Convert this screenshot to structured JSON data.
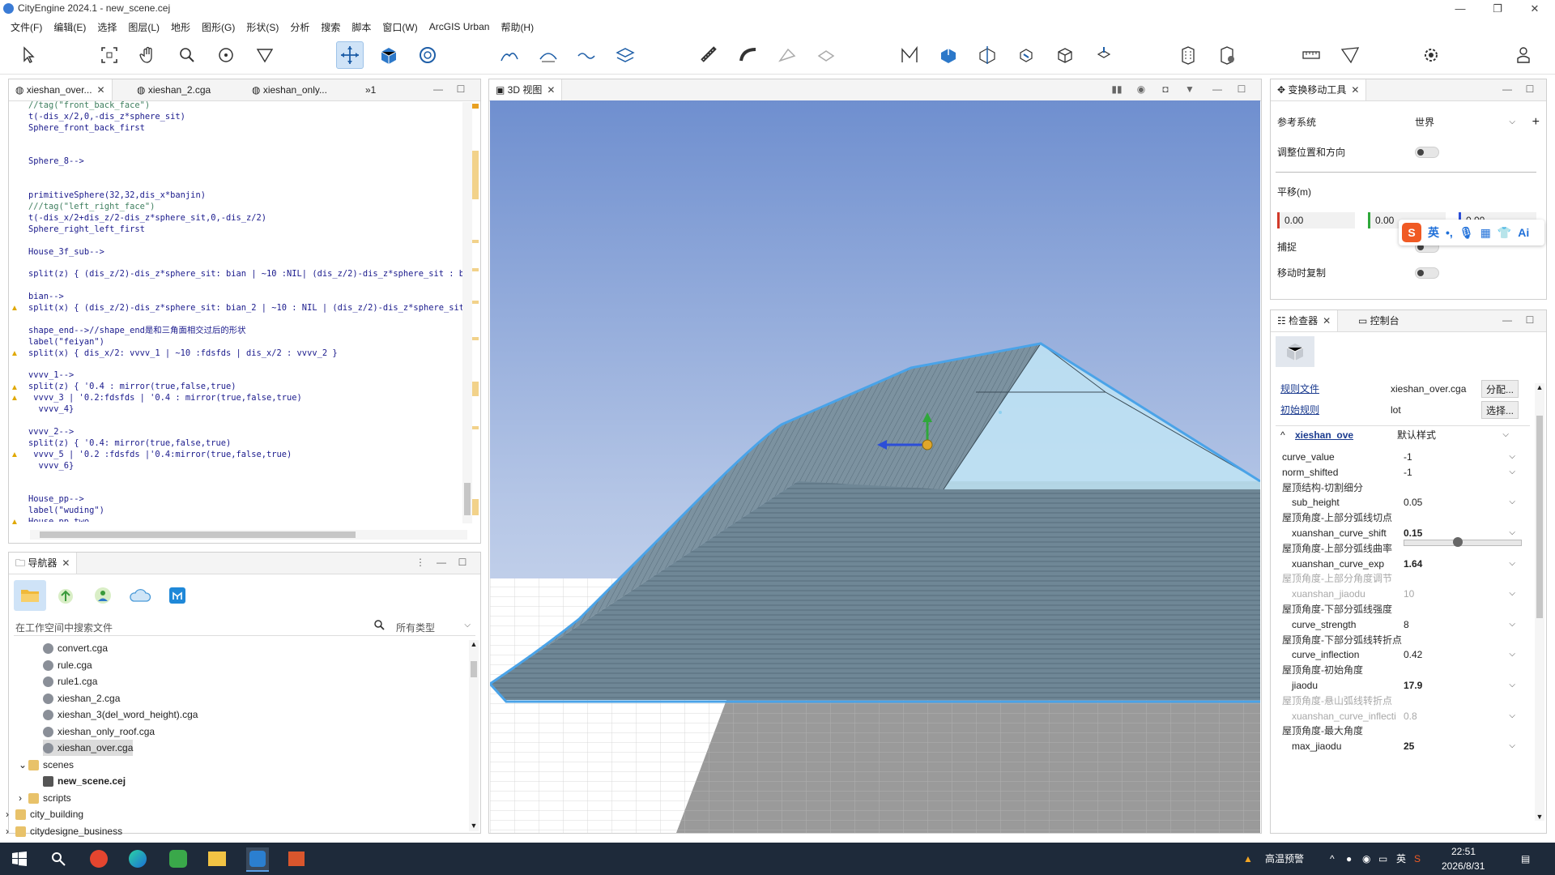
{
  "window": {
    "title": "CityEngine 2024.1 - new_scene.cej",
    "controls": [
      "—",
      "❐",
      "✕"
    ]
  },
  "menu": [
    "文件(F)",
    "编辑(E)",
    "选择",
    "图层(L)",
    "地形",
    "图形(G)",
    "形状(S)",
    "分析",
    "搜索",
    "脚本",
    "窗口(W)",
    "ArcGIS Urban",
    "帮助(H)"
  ],
  "editor": {
    "tabs": [
      "xieshan_over...",
      "xieshan_2.cga",
      "xieshan_only...",
      "»1"
    ],
    "lines": [
      "//tag(\"front_back_face\")",
      "t(-dis_x/2,0,-dis_z*sphere_sit)",
      "Sphere_front_back_first",
      "",
      "",
      "Sphere_8-->",
      "",
      "",
      "primitiveSphere(32,32,dis_x*banjin)",
      "///tag(\"left_right_face\")",
      "t(-dis_x/2+dis_z/2-dis_z*sphere_sit,0,-dis_z/2)",
      "Sphere_right_left_first",
      "",
      "House_3f_sub-->",
      "",
      "split(z) { (dis_z/2)-dis_z*sphere_sit: bian | ~10 :NIL| (dis_z/2)-dis_z*sphere_sit : bia",
      "",
      "bian-->",
      "split(x) { (dis_z/2)-dis_z*sphere_sit: bian_2 | ~10 : NIL | (dis_z/2)-dis_z*sphere_sit :",
      "",
      "shape_end-->//shape_end是和三角面相交过后的形状",
      "label(\"feiyan\")",
      "split(x) { dis_x/2: vvvv_1 | ~10 :fdsfds | dis_x/2 : vvvv_2 }",
      "",
      "vvvv_1-->",
      "split(z) { '0.4 : mirror(true,false,true)",
      " vvvv_3 | '0.2:fdsfds | '0.4 : mirror(true,false,true)",
      "  vvvv_4}",
      "",
      "vvvv_2-->",
      "split(z) { '0.4: mirror(true,false,true)",
      " vvvv_5 | '0.2 :fdsfds |'0.4:mirror(true,false,true)",
      "  vvvv_6}",
      "",
      "",
      "House_pp-->",
      "label(\"wuding\")",
      "House_pp_two"
    ]
  },
  "navigator": {
    "tab": "导航器",
    "search_placeholder": "在工作空间中搜索文件",
    "type_filter": "所有类型",
    "tree": [
      {
        "label": "convert.cga",
        "kind": "cga",
        "level": 2
      },
      {
        "label": "rule.cga",
        "kind": "cga",
        "level": 2
      },
      {
        "label": "rule1.cga",
        "kind": "cga",
        "level": 2
      },
      {
        "label": "xieshan_2.cga",
        "kind": "cga",
        "level": 2
      },
      {
        "label": "xieshan_3(del_word_height).cga",
        "kind": "cga",
        "level": 2
      },
      {
        "label": "xieshan_only_roof.cga",
        "kind": "cga",
        "level": 2
      },
      {
        "label": "xieshan_over.cga",
        "kind": "cga",
        "level": 2,
        "selected": true
      },
      {
        "label": "scenes",
        "kind": "folder",
        "level": 1,
        "expanded": true
      },
      {
        "label": "new_scene.cej",
        "kind": "scene",
        "level": 2,
        "bold": true
      },
      {
        "label": "scripts",
        "kind": "folder",
        "level": 1
      },
      {
        "label": "city_building",
        "kind": "folder",
        "level": 0
      },
      {
        "label": "citydesigne_business",
        "kind": "folder",
        "level": 0
      }
    ]
  },
  "view3d": {
    "tab": "3D 视图"
  },
  "transform": {
    "tab": "变换移动工具",
    "ref_label": "参考系统",
    "ref_value": "世界",
    "adjust_label": "调整位置和方向",
    "translate_label": "平移(m)",
    "x": "0.00",
    "y": "0.00",
    "z": "0.00",
    "snap_label": "捕捉",
    "copy_label": "移动时复制"
  },
  "ime": {
    "lang": "英",
    "ai": "Ai"
  },
  "inspector": {
    "tabs": [
      "检查器",
      "控制台"
    ],
    "rule_file_label": "规则文件",
    "rule_file_value": "xieshan_over.cga",
    "assign_button": "分配...",
    "start_rule_label": "初始规则",
    "start_rule_value": "lot",
    "select_button": "选择...",
    "style_name": "xieshan_ove",
    "style_value": "默认样式",
    "attributes": [
      {
        "label": "curve_value",
        "value": "-1",
        "kind": "attr"
      },
      {
        "label": "norm_shifted",
        "value": "-1",
        "kind": "attr"
      },
      {
        "label": "屋顶结构-切割细分",
        "kind": "group"
      },
      {
        "label": "sub_height",
        "value": "0.05",
        "kind": "attr",
        "indent": true
      },
      {
        "label": "屋顶角度-上部分弧线切点",
        "kind": "group"
      },
      {
        "label": "xuanshan_curve_shift",
        "value": "0.15",
        "kind": "attr",
        "indent": true,
        "bold": true,
        "slider": 0.45
      },
      {
        "label": "屋顶角度-上部分弧线曲率",
        "kind": "group"
      },
      {
        "label": "xuanshan_curve_exp",
        "value": "1.64",
        "kind": "attr",
        "indent": true,
        "bold": true
      },
      {
        "label": "屋顶角度-上部分角度调节",
        "kind": "group",
        "disabled": true
      },
      {
        "label": "xuanshan_jiaodu",
        "value": "10",
        "kind": "attr",
        "indent": true,
        "disabled": true
      },
      {
        "label": "屋顶角度-下部分弧线强度",
        "kind": "group"
      },
      {
        "label": "curve_strength",
        "value": "8",
        "kind": "attr",
        "indent": true
      },
      {
        "label": "屋顶角度-下部分弧线转折点",
        "kind": "group"
      },
      {
        "label": "curve_inflection",
        "value": "0.42",
        "kind": "attr",
        "indent": true
      },
      {
        "label": "屋顶角度-初始角度",
        "kind": "group"
      },
      {
        "label": "jiaodu",
        "value": "17.9",
        "kind": "attr",
        "indent": true,
        "bold": true
      },
      {
        "label": "屋顶角度-悬山弧线转折点",
        "kind": "group",
        "disabled": true
      },
      {
        "label": "xuanshan_curve_inflecti",
        "value": "0.8",
        "kind": "attr",
        "indent": true,
        "disabled": true
      },
      {
        "label": "屋顶角度-最大角度",
        "kind": "group"
      },
      {
        "label": "max_jiaodu",
        "value": "25",
        "kind": "attr",
        "indent": true,
        "bold": true
      }
    ]
  },
  "taskbar": {
    "weather": "高温预警",
    "ime_lang": "英",
    "time": "22:51",
    "date": "2026/8/31"
  },
  "colors": {
    "accent": "#4aa3e8",
    "sky_top": "#6f8fcf",
    "sky_bottom": "#d9e3f2",
    "roof": "#6f8796",
    "ground": "#9a9a9a",
    "taskbar": "#1e2a3a"
  }
}
